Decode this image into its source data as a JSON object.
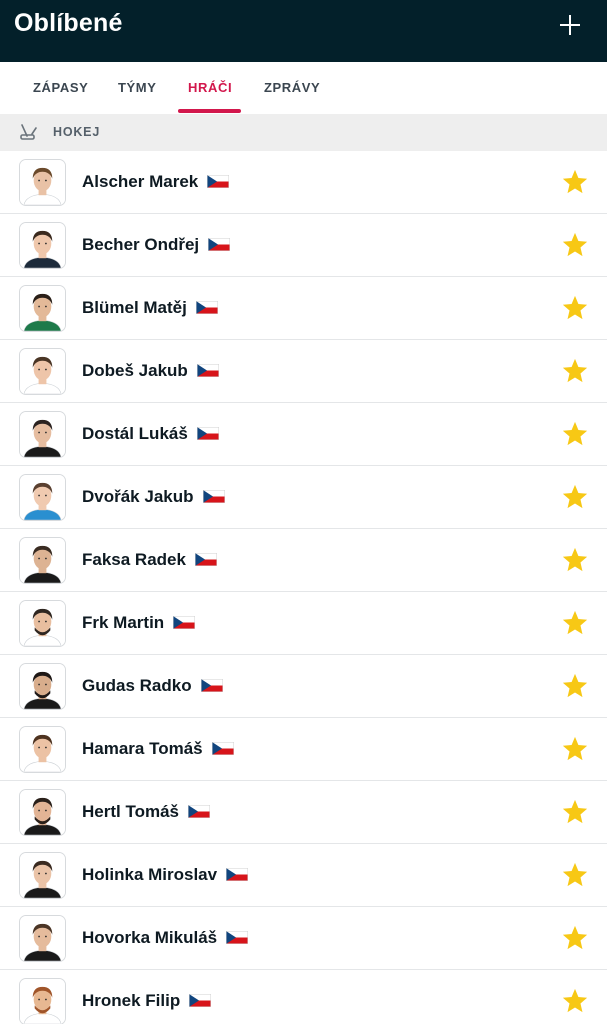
{
  "header": {
    "title": "Oblíbené",
    "add_icon": "plus-icon"
  },
  "tabs": [
    {
      "label": "ZÁPASY",
      "active": false
    },
    {
      "label": "TÝMY",
      "active": false
    },
    {
      "label": "HRÁČI",
      "active": true
    },
    {
      "label": "ZPRÁVY",
      "active": false
    }
  ],
  "section": {
    "label": "HOKEJ",
    "icon": "hockey-icon"
  },
  "players": [
    {
      "name": "Alscher Marek",
      "flag": "czech-flag-icon",
      "favorite": true
    },
    {
      "name": "Becher Ondřej",
      "flag": "czech-flag-icon",
      "favorite": true
    },
    {
      "name": "Blümel Matěj",
      "flag": "czech-flag-icon",
      "favorite": true
    },
    {
      "name": "Dobeš Jakub",
      "flag": "czech-flag-icon",
      "favorite": true
    },
    {
      "name": "Dostál Lukáš",
      "flag": "czech-flag-icon",
      "favorite": true
    },
    {
      "name": "Dvořák Jakub",
      "flag": "czech-flag-icon",
      "favorite": true
    },
    {
      "name": "Faksa Radek",
      "flag": "czech-flag-icon",
      "favorite": true
    },
    {
      "name": "Frk Martin",
      "flag": "czech-flag-icon",
      "favorite": true
    },
    {
      "name": "Gudas Radko",
      "flag": "czech-flag-icon",
      "favorite": true
    },
    {
      "name": "Hamara Tomáš",
      "flag": "czech-flag-icon",
      "favorite": true
    },
    {
      "name": "Hertl Tomáš",
      "flag": "czech-flag-icon",
      "favorite": true
    },
    {
      "name": "Holinka Miroslav",
      "flag": "czech-flag-icon",
      "favorite": true
    },
    {
      "name": "Hovorka Mikuláš",
      "flag": "czech-flag-icon",
      "favorite": true
    },
    {
      "name": "Hronek Filip",
      "flag": "czech-flag-icon",
      "favorite": true
    }
  ],
  "colors": {
    "header_bg": "#03202a",
    "accent": "#d2174c",
    "star": "#f7c815",
    "section_bg": "#eeeeee"
  }
}
